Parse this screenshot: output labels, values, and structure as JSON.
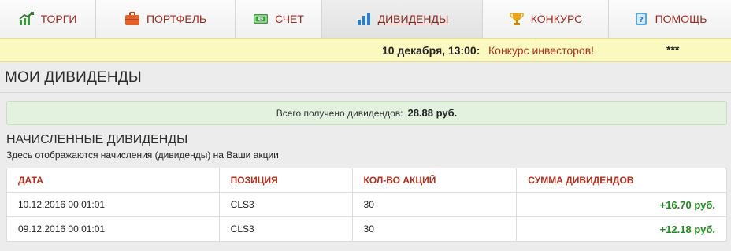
{
  "nav": {
    "items": [
      {
        "label": "ТОРГИ",
        "icon": "chart-growth-icon"
      },
      {
        "label": "ПОРТФЕЛЬ",
        "icon": "briefcase-icon"
      },
      {
        "label": "СЧЕТ",
        "icon": "money-icon"
      },
      {
        "label": "ДИВИДЕНДЫ",
        "icon": "bar-chart-icon",
        "active": true
      },
      {
        "label": "КОНКУРС",
        "icon": "trophy-icon"
      },
      {
        "label": "ПОМОЩЬ",
        "icon": "help-book-icon"
      }
    ]
  },
  "announcement": {
    "date": "10 декабря, 13:00:",
    "link": "Конкурс инвесторов!",
    "stars": "***"
  },
  "page": {
    "title": "МОИ ДИВИДЕНДЫ"
  },
  "summary": {
    "label": "Всего получено дивидендов:",
    "value": "28.88 руб."
  },
  "section": {
    "title": "НАЧИСЛЕННЫЕ ДИВИДЕНДЫ",
    "description": "Здесь отображаются начисления (дивиденды) на Ваши акции"
  },
  "table": {
    "headers": [
      "ДАТА",
      "ПОЗИЦИЯ",
      "КОЛ-ВО АКЦИЙ",
      "СУММА ДИВИДЕНДОВ"
    ],
    "rows": [
      {
        "date": "10.12.2016 00:01:01",
        "position": "CLS3",
        "qty": "30",
        "sum": "+16.70 руб."
      },
      {
        "date": "09.12.2016 00:01:01",
        "position": "CLS3",
        "qty": "30",
        "sum": "+12.18 руб."
      }
    ]
  },
  "colors": {
    "accent": "#a12a1e",
    "positive": "#1f8a1f",
    "announce_bg": "#fbf8c0",
    "summary_bg": "#e2f2df"
  }
}
